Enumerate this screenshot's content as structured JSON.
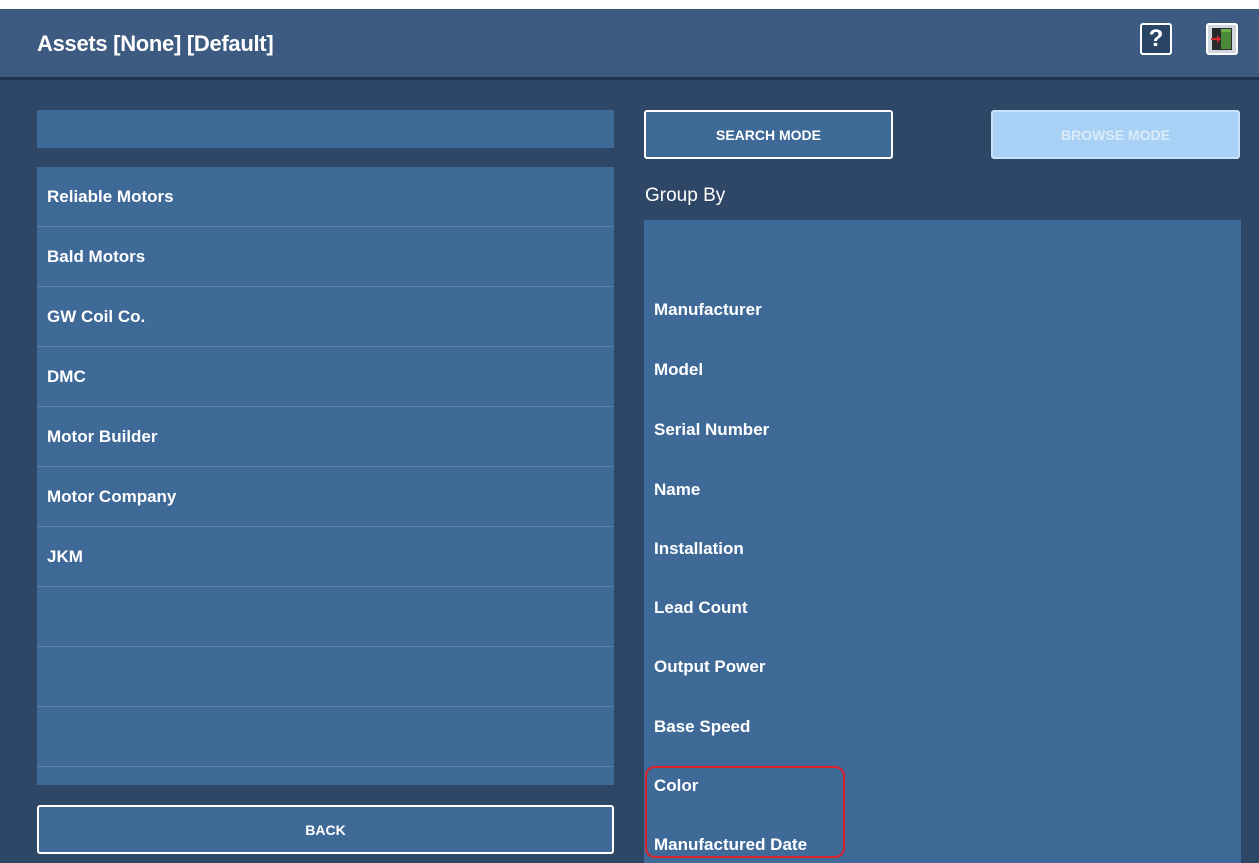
{
  "header": {
    "title": "Assets  [None] [Default]",
    "help_icon_label": "?",
    "help_icon": "question-mark-icon",
    "exit_icon": "exit-door-icon"
  },
  "search": {
    "value": ""
  },
  "asset_list": {
    "items": [
      "Reliable Motors",
      "Bald Motors",
      "GW Coil Co.",
      "DMC",
      "Motor Builder",
      "Motor Company",
      "JKM",
      "",
      "",
      ""
    ]
  },
  "buttons": {
    "back": "BACK",
    "search_mode": "SEARCH MODE",
    "browse_mode": "BROWSE MODE"
  },
  "group_by": {
    "label": "Group By",
    "options": [
      "",
      "Manufacturer",
      "Model",
      "Serial Number",
      "Name",
      "Installation",
      "Lead Count",
      "Output Power",
      "Base Speed",
      "Color",
      "Manufactured Date"
    ]
  },
  "colors": {
    "header_bg": "#3d5a80",
    "app_bg": "#2e4767",
    "panel_bg": "#3f6a98",
    "browse_disabled_bg": "#a9d1f5",
    "highlight_border": "#d9222a"
  }
}
